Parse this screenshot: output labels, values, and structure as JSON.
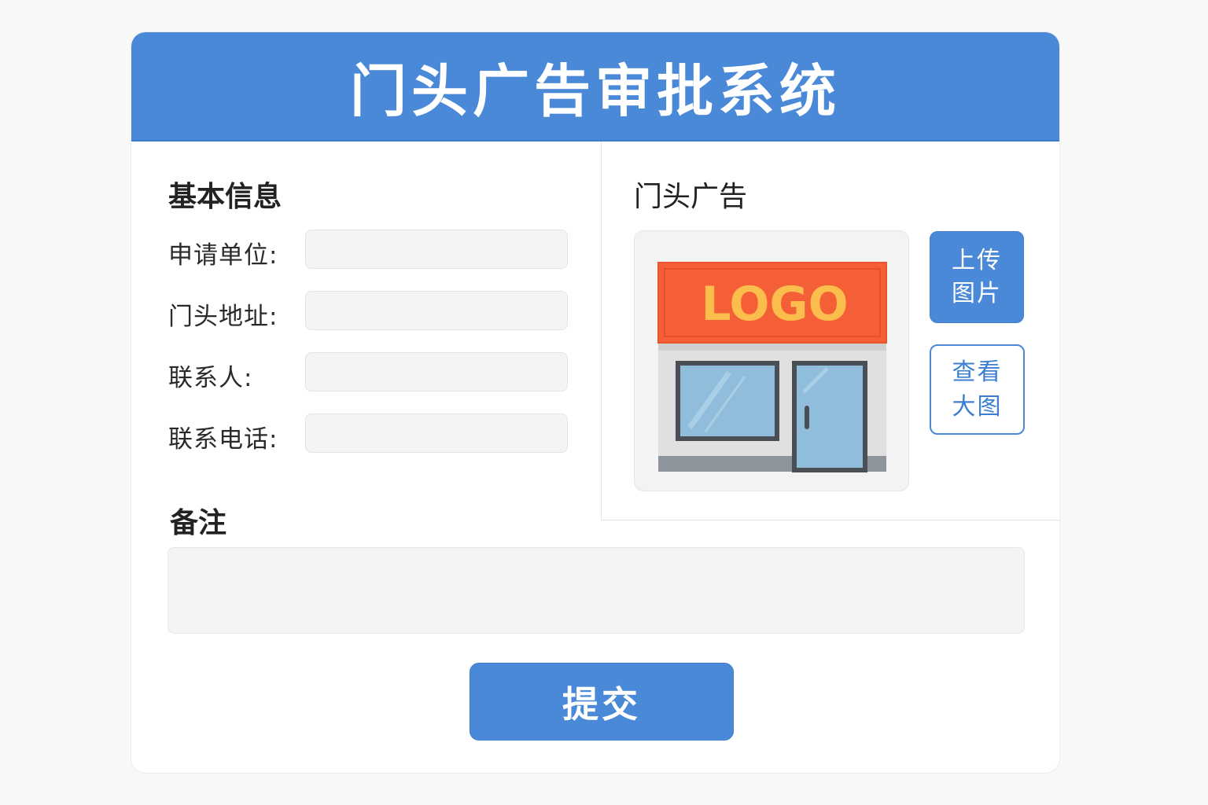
{
  "header": {
    "title": "门头广告审批系统"
  },
  "basic_info": {
    "title": "基本信息",
    "fields": [
      {
        "label": "申请单位:",
        "value": "",
        "placeholder": ""
      },
      {
        "label": "门头地址:",
        "value": "",
        "placeholder": ""
      },
      {
        "label": "联系人:",
        "value": "",
        "placeholder": ""
      },
      {
        "label": "联系电话:",
        "value": "",
        "placeholder": ""
      }
    ]
  },
  "ad": {
    "title": "门头广告",
    "preview_logo_text": "LOGO",
    "upload_button": {
      "line1": "上传",
      "line2": "图片"
    },
    "view_button": {
      "line1": "查看",
      "line2": "大图"
    }
  },
  "remarks": {
    "title": "备注",
    "value": "",
    "placeholder": ""
  },
  "submit_label": "提交",
  "colors": {
    "primary": "#4a89d8",
    "background": "#f8f8f9",
    "card": "#ffffff",
    "input_bg": "#f4f4f5",
    "logo_sign": "#f45f37",
    "logo_text": "#fbbd4c",
    "glass": "#8fbddb"
  },
  "icons": {
    "preview": "storefront-illustration"
  }
}
